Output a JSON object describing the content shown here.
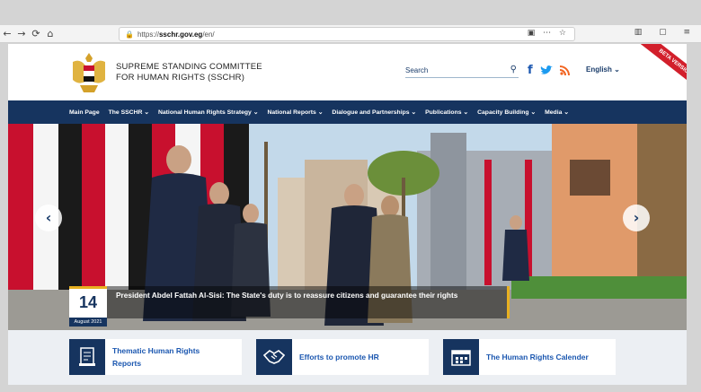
{
  "browser": {
    "url_prefix": "https://",
    "url_host": "sschr.gov.eg",
    "url_path": "/en/",
    "nav_icons": [
      "←",
      "→",
      "⟳",
      "⌂"
    ]
  },
  "header": {
    "org_line1": "SUPREME STANDING COMMITTEE",
    "org_line2": "FOR HUMAN RIGHTS (SSCHR)",
    "search_placeholder": "Search",
    "language": "English ⌄",
    "beta_label": "BETA VERSION"
  },
  "nav": {
    "items": [
      "Main Page",
      "The SSCHR ⌄",
      "National Human Rights Strategy ⌄",
      "National Reports ⌄",
      "Dialogue and Partnerships ⌄",
      "Publications ⌄",
      "Capacity Building ⌄",
      "Media ⌄"
    ]
  },
  "hero": {
    "day": "14",
    "month": "August 2021",
    "caption": "President Abdel Fattah Al-Sisi: The State's duty is to reassure citizens and guarantee their rights"
  },
  "cards": [
    {
      "title_line1": "Thematic Human Rights",
      "title_line2": "Reports",
      "icon": "report-icon"
    },
    {
      "title_line1": "Efforts to promote HR",
      "title_line2": "",
      "icon": "handshake-icon"
    },
    {
      "title_line1": "The Human Rights Calender",
      "title_line2": "",
      "icon": "calendar-icon"
    }
  ],
  "colors": {
    "navy": "#16345f",
    "accent": "#e8b020",
    "link": "#1b57b0",
    "beta": "#d21f2b"
  }
}
